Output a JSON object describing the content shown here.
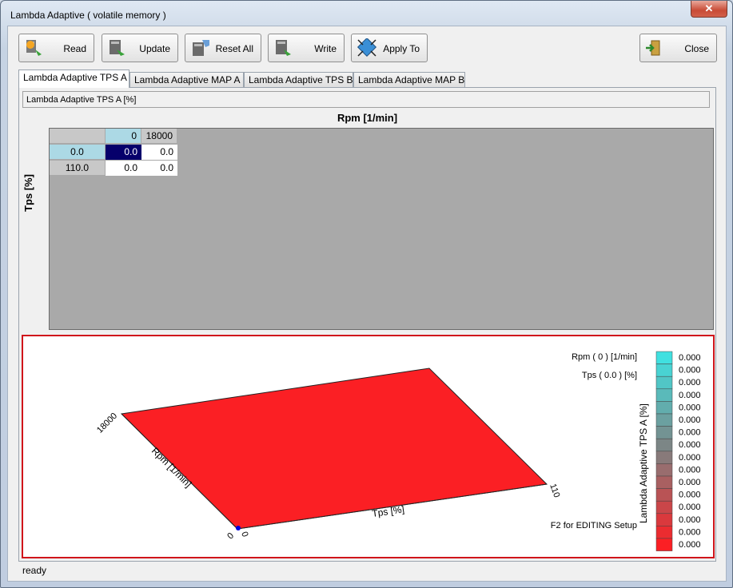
{
  "window": {
    "title": "Lambda Adaptive ( volatile memory )"
  },
  "toolbar": {
    "read": "Read",
    "update": "Update",
    "reset_all": "Reset All",
    "write": "Write",
    "apply_to": "Apply To",
    "close": "Close"
  },
  "tabs": [
    "Lambda Adaptive TPS A",
    "Lambda Adaptive MAP A",
    "Lambda Adaptive TPS B",
    "Lambda Adaptive MAP B"
  ],
  "table": {
    "group_title": "Lambda Adaptive TPS A [%]",
    "col_axis_label": "Rpm  [1/min]",
    "row_axis_label": "Tps  [%]",
    "col_headers": [
      "0",
      "18000"
    ],
    "row_headers": [
      "0.0",
      "110.0"
    ],
    "values": [
      [
        "0.0",
        "0.0"
      ],
      [
        "0.0",
        "0.0"
      ]
    ]
  },
  "chart_data": {
    "type": "surface",
    "x_axis": {
      "label": "Tps  [%]",
      "ticks": [
        "0",
        "110"
      ]
    },
    "y_axis": {
      "label": "Rpm  [1/min]",
      "ticks": [
        "0",
        "18000"
      ]
    },
    "z_label": "Lambda Adaptive TPS A  [%]",
    "cursor_rpm": "Rpm ( 0 ) [1/min]",
    "cursor_tps": "Tps ( 0.0 ) [%]",
    "hint": "F2 for EDITING Setup",
    "legend_values": [
      "0.000",
      "0.000",
      "0.000",
      "0.000",
      "0.000",
      "0.000",
      "0.000",
      "0.000",
      "0.000",
      "0.000",
      "0.000",
      "0.000",
      "0.000",
      "0.000",
      "0.000",
      "0.000"
    ],
    "surface_color": "#fb1f24"
  },
  "status": {
    "text": "ready"
  }
}
